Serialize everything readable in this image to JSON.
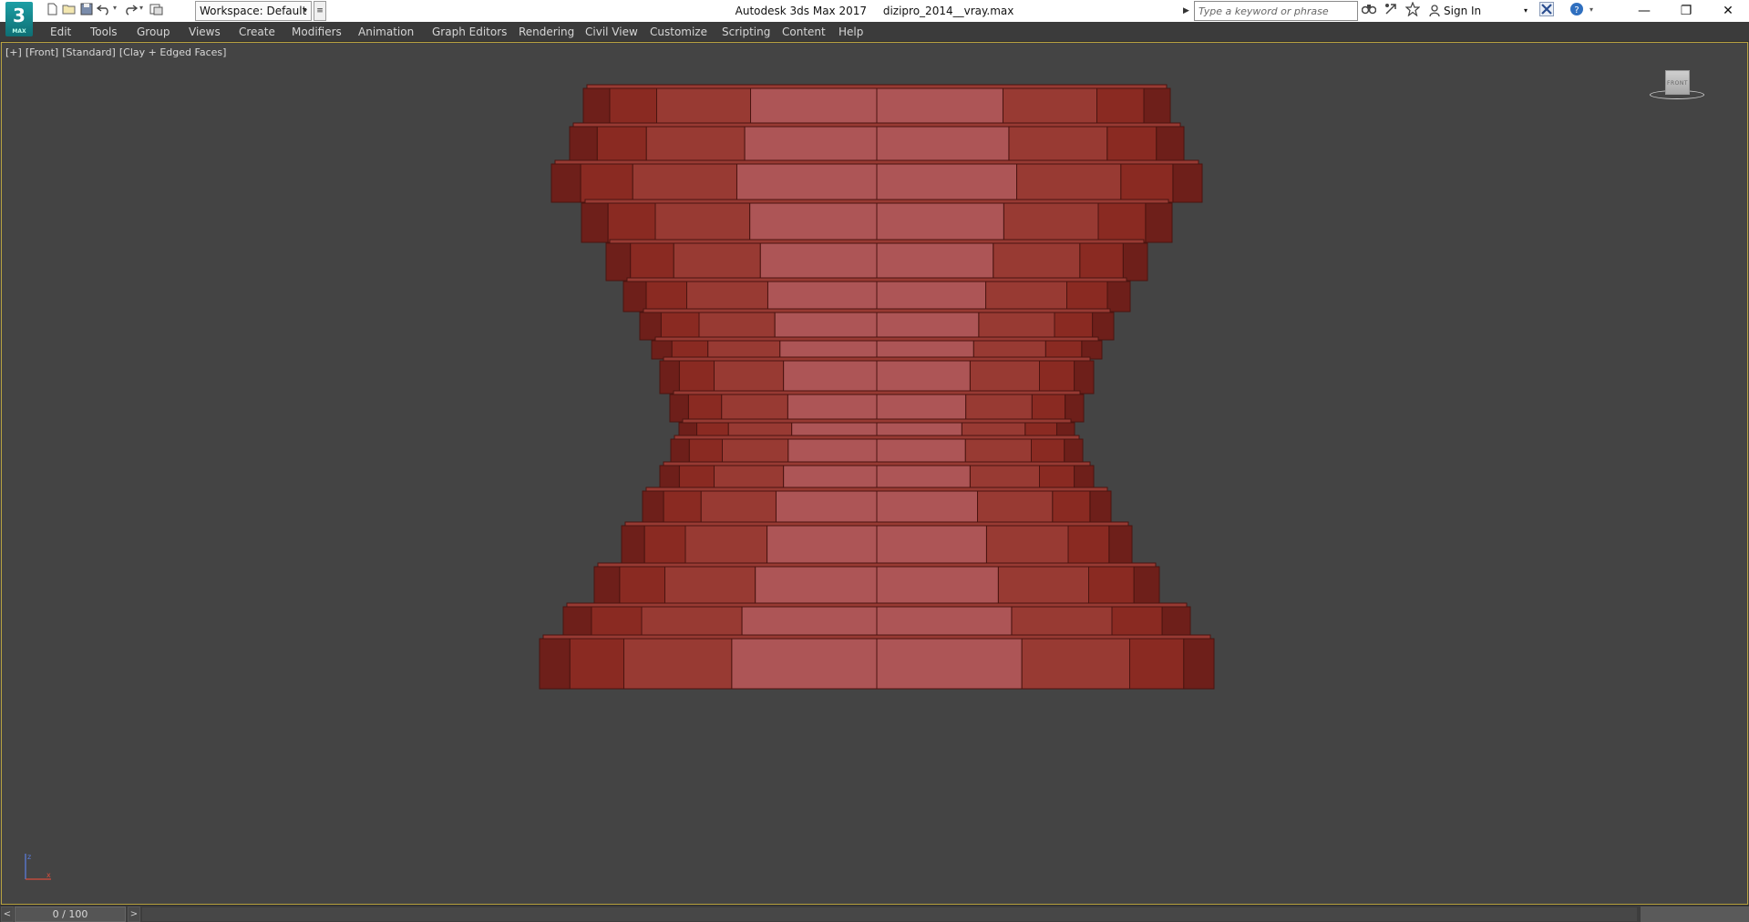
{
  "titlebar": {
    "app_name": "Autodesk 3ds Max 2017",
    "file_name": "dizipro_2014__vray.max",
    "logo_text": "3",
    "logo_sub": "MAX",
    "workspace_label": "Workspace: Default",
    "search_placeholder": "Type a keyword or phrase",
    "sign_in_label": "Sign In"
  },
  "menubar": {
    "items": [
      "Edit",
      "Tools",
      "Group",
      "Views",
      "Create",
      "Modifiers",
      "Animation",
      "Graph Editors",
      "Rendering",
      "Civil View",
      "Customize",
      "Scripting",
      "Content",
      "Help"
    ]
  },
  "viewport": {
    "label_plus": "[+]",
    "label_view": "[Front]",
    "label_mode": "[Standard]",
    "label_shading": "[Clay + Edged Faces]",
    "viewcube_face": "FRONT"
  },
  "model_colors": {
    "dark": "#6e1f1a",
    "mid": "#8a2a22",
    "base": "#983a33",
    "light": "#ad5556",
    "highlight": "#b46466",
    "edge": "#4a1410"
  },
  "timeslider": {
    "frame_readout": "0 / 100",
    "prev_label": "<",
    "next_label": ">"
  },
  "icons": {
    "new": "new-file-icon",
    "open": "open-folder-icon",
    "save": "save-icon",
    "undo": "undo-icon",
    "redo": "redo-icon",
    "project": "project-folder-icon",
    "binoculars": "binoculars-icon",
    "star": "favorites-star-icon",
    "user": "user-icon",
    "exchange": "autodesk-exchange-icon",
    "help": "help-icon"
  }
}
